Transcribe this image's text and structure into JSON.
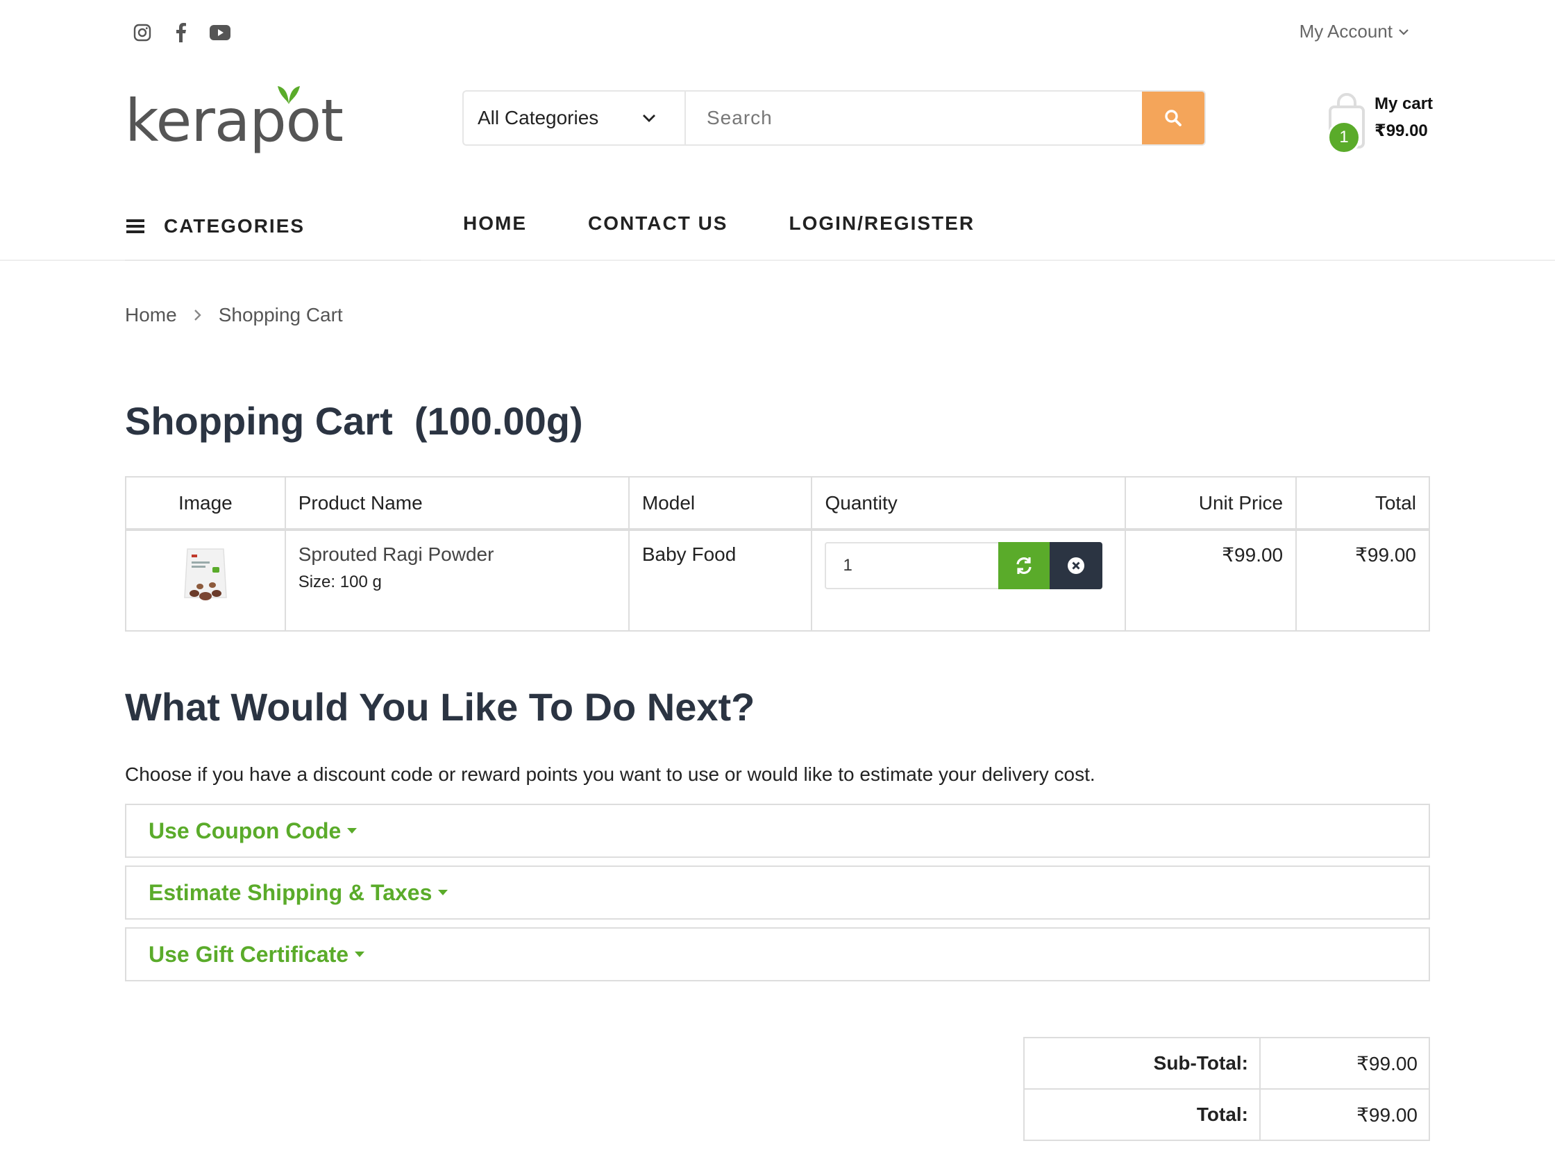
{
  "header": {
    "account_label": "My Account",
    "logo_text": "kerapot",
    "category_select": "All Categories",
    "search_placeholder": "Search",
    "cart_label": "My cart",
    "cart_amount": "₹99.00",
    "cart_count": "1"
  },
  "social": [
    "instagram-icon",
    "facebook-icon",
    "youtube-icon"
  ],
  "nav": {
    "categories_label": "CATEGORIES",
    "items": [
      "HOME",
      "CONTACT US",
      "LOGIN/REGISTER"
    ]
  },
  "breadcrumb": [
    "Home",
    "Shopping Cart"
  ],
  "page_title": "Shopping Cart  (100.00g)",
  "table": {
    "headers": [
      "Image",
      "Product Name",
      "Model",
      "Quantity",
      "Unit Price",
      "Total"
    ],
    "rows": [
      {
        "name": "Sprouted Ragi Powder",
        "size": "Size: 100 g",
        "model": "Baby Food",
        "quantity": "1",
        "unit_price": "₹99.00",
        "total": "₹99.00"
      }
    ]
  },
  "next": {
    "title": "What Would You Like To Do Next?",
    "description": "Choose if you have a discount code or reward points you want to use or would like to estimate your delivery cost.",
    "panels": [
      "Use Coupon Code",
      "Estimate Shipping & Taxes",
      "Use Gift Certificate"
    ]
  },
  "totals": [
    {
      "label": "Sub-Total:",
      "value": "₹99.00"
    },
    {
      "label": "Total:",
      "value": "₹99.00"
    }
  ],
  "colors": {
    "accent_green": "#5aab2a",
    "search_orange": "#f4a55a",
    "dark_navy": "#2b3442"
  }
}
